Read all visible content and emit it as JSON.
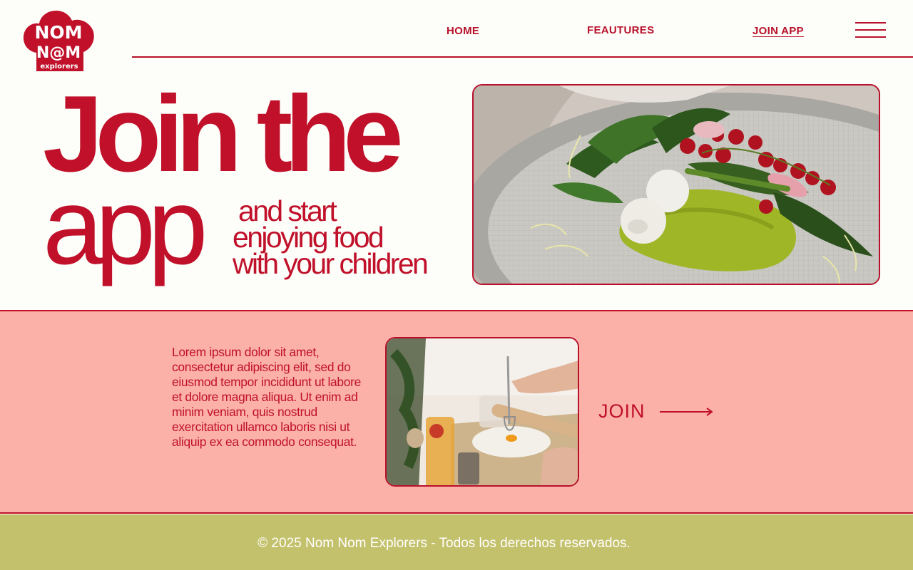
{
  "brand": {
    "logo_line1": "NOM",
    "logo_line2": "N@M",
    "logo_line3": "explorers"
  },
  "nav": {
    "items": [
      {
        "label": "HOME"
      },
      {
        "label": "FEAUTURES"
      },
      {
        "label": "JOIN APP"
      }
    ],
    "menu_icon": "hamburger-menu-icon"
  },
  "hero": {
    "line1": "Join the",
    "line2": "app",
    "subtitle_lines": [
      "and start",
      "enjoying food",
      "with your children"
    ],
    "photo": "plate-with-green-puree-mozzarella-and-salad"
  },
  "promo": {
    "body": "Lorem ipsum dolor sit amet, consectetur adipiscing elit, sed do eiusmod tempor incididunt ut labore et dolore magna aliqua. Ut enim ad minim veniam, quis nostrud exercitation ullamco laboris nisi ut aliquip ex ea commodo consequat.",
    "photo": "hands-whisking-egg-in-flour",
    "cta_label": "JOIN",
    "cta_icon": "arrow-right-icon"
  },
  "footer": {
    "text": "© 2025 Nom Nom Explorers - Todos los derechos reservados."
  },
  "colors": {
    "primary": "#c0102a",
    "background": "#fdfefa",
    "band": "#fbb1a7",
    "footer": "#c4c16c"
  }
}
